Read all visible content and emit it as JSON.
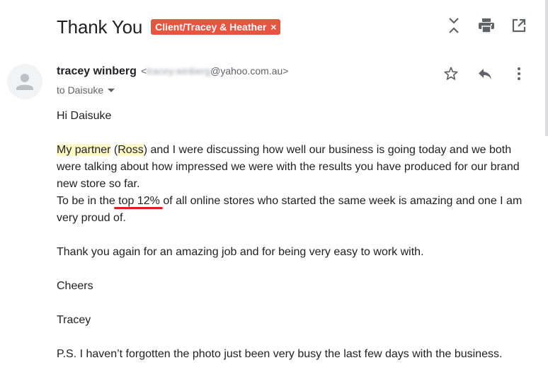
{
  "header": {
    "subject": "Thank You",
    "label": "Client/Tracey & Heather",
    "label_remove": "×",
    "label_color": "#e8543f",
    "actions": [
      "collapse-all-icon",
      "print-icon",
      "open-in-new-window-icon"
    ]
  },
  "message": {
    "sender_name": "tracey winberg",
    "sender_email_prefix": "<",
    "sender_email_blurred": "tracey.winberg",
    "sender_email_domain": "@yahoo.com.au>",
    "to_line": "to Daisuke",
    "actions": [
      "star-icon",
      "reply-icon",
      "more-vert-icon"
    ]
  },
  "body": {
    "greeting": "Hi Daisuke",
    "p1_part1": "My partner",
    "p1_part2": " (",
    "p1_part3": "Ross",
    "p1_part4": ") and I were discussing how well our business is going today and we both were talking about how impressed we were with the results you have produced for our brand new store so far.",
    "p2_part1": "To be in the ",
    "p2_part2": "top 12%",
    "p2_part3": " of all online stores who started the same  week is amazing and one I am very proud of.",
    "p3": "Thank you again for an amazing job and for  being very easy to work with.",
    "closing": "Cheers",
    "signature": "Tracey",
    "ps": "P.S. I haven’t forgotten the photo just been very busy the last few days with the business."
  }
}
